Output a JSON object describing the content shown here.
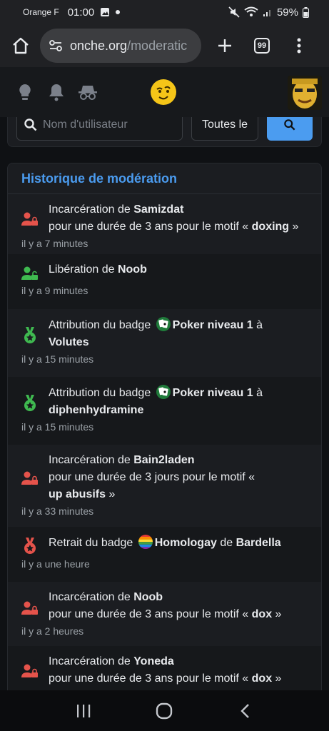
{
  "status_bar": {
    "carrier": "Orange F",
    "time": "01:00",
    "battery": "59%"
  },
  "browser": {
    "url_host": "onche.org",
    "url_path": "/moderatic",
    "tab_count": "99"
  },
  "search": {
    "placeholder": "Nom d'utilisateur",
    "filter_value": "Toutes le"
  },
  "history": {
    "title": "Historique de modération",
    "entries": [
      {
        "type": "incarceration",
        "p1": "Incarcération de ",
        "user": "Samizdat",
        "p2": "pour une durée de 3 ans pour le motif « ",
        "reason": "doxing",
        "p3": " »",
        "time": "il y a 7 minutes"
      },
      {
        "type": "liberation",
        "p1": "Libération de ",
        "user": "Noob",
        "time": "il y a 9 minutes"
      },
      {
        "type": "attribution",
        "p1": "Attribution du badge ",
        "badge": "Poker niveau 1",
        "p2": " à",
        "user": "Volutes",
        "time": "il y a 15 minutes"
      },
      {
        "type": "attribution",
        "p1": "Attribution du badge ",
        "badge": "Poker niveau 1",
        "p2": " à",
        "user": "diphenhydramine",
        "time": "il y a 15 minutes"
      },
      {
        "type": "incarceration",
        "p1": "Incarcération de ",
        "user": "Bain2laden",
        "p2": "pour une durée de 3 jours pour le motif «",
        "reason": "up abusifs",
        "p3": " »",
        "time": "il y a 33 minutes"
      },
      {
        "type": "retrait",
        "p1": "Retrait du badge ",
        "badge": "Homologay",
        "p2": " de ",
        "user": "Bardella",
        "time": "il y a une heure"
      },
      {
        "type": "incarceration",
        "p1": "Incarcération de ",
        "user": "Noob",
        "p2": "pour une durée de 3 ans pour le motif « ",
        "reason": "dox",
        "p3": " »",
        "time": "il y a 2 heures"
      },
      {
        "type": "incarceration",
        "p1": "Incarcération de ",
        "user": "Yoneda",
        "p2": "pour une durée de 3 ans pour le motif « ",
        "reason": "dox",
        "p3": " »",
        "time": ""
      }
    ]
  },
  "colors": {
    "accent": "#4b9cf0",
    "danger": "#e5534b",
    "success": "#3fb950"
  },
  "icons": [
    "home-icon",
    "site-settings-icon",
    "plus-icon",
    "tabs-icon",
    "more-icon",
    "lightbulb-icon",
    "bell-icon",
    "incognito-icon",
    "search-icon",
    "user-lock-icon",
    "medal-icon",
    "poker-badge-icon",
    "rainbow-badge-icon"
  ]
}
